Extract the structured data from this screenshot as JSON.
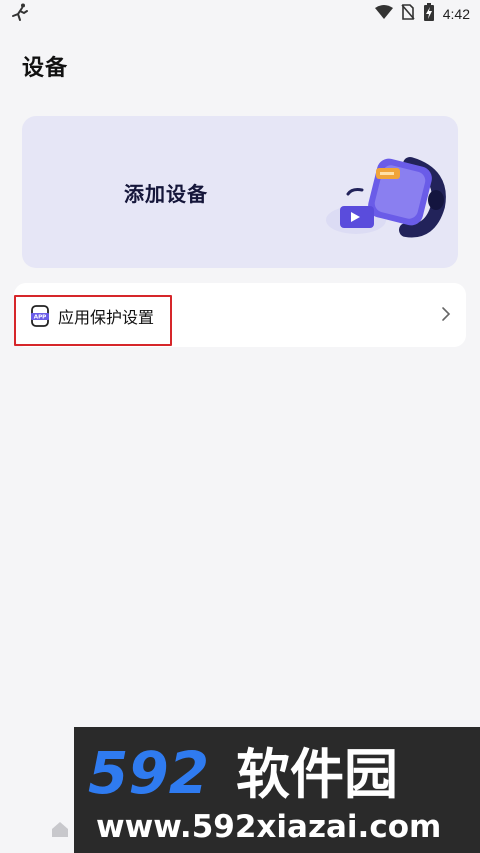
{
  "status_bar": {
    "time": "4:42",
    "left_icon": "running-figure-icon",
    "right_icons": [
      "wifi-icon",
      "no-sim-icon",
      "battery-charging-icon"
    ]
  },
  "page": {
    "title": "设备"
  },
  "add_device_card": {
    "label": "添加设备",
    "illustration": "smartwatch-illustration",
    "bg_color": "#e6e6f6"
  },
  "settings": {
    "app_protection": {
      "label": "应用保护设置",
      "icon": "app-protect-icon",
      "icon_text": "APP",
      "chevron": "chevron-right-icon"
    }
  },
  "watermark": {
    "brand": "592软件园",
    "url": "www.592xiazai.com"
  },
  "colors": {
    "highlight": "#d6262a",
    "accent": "#5a4cdc",
    "page_bg": "#f5f5f7"
  }
}
